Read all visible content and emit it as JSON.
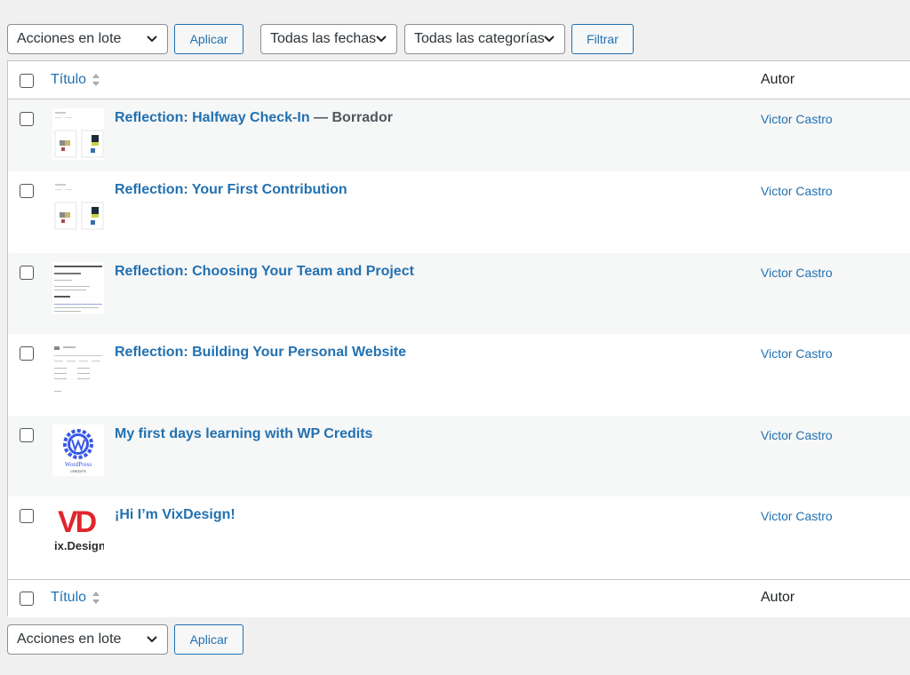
{
  "toolbar_top": {
    "bulk_actions": "Acciones en lote",
    "apply": "Aplicar",
    "dates_filter": "Todas las fechas",
    "categories_filter": "Todas las categorías",
    "filter": "Filtrar"
  },
  "table": {
    "col_title": "Título",
    "col_author": "Autor",
    "rows": [
      {
        "title": "Reflection: Halfway Check-In",
        "state": " — Borrador",
        "author": "Victor Castro"
      },
      {
        "title": "Reflection: Your First Contribution",
        "state": "",
        "author": "Victor Castro"
      },
      {
        "title": "Reflection: Choosing Your Team and Project",
        "state": "",
        "author": "Victor Castro"
      },
      {
        "title": "Reflection: Building Your Personal Website",
        "state": "",
        "author": "Victor Castro"
      },
      {
        "title": "My first days learning with WP Credits",
        "state": "",
        "author": "Victor Castro"
      },
      {
        "title": "¡Hi I’m VixDesign!",
        "state": "",
        "author": "Victor Castro"
      }
    ]
  },
  "toolbar_bottom": {
    "bulk_actions": "Acciones en lote",
    "apply": "Aplicar"
  },
  "thumbnails": {
    "wp_logo_text": "WordPress",
    "wp_logo_sub": "CREDITS",
    "vd_logo": "VD",
    "vd_logo_sub": "ix.Design"
  },
  "colors": {
    "link": "#2271b1",
    "background": "#f0f0f1",
    "border": "#c3c4c7",
    "vd_red": "#e0252d"
  }
}
